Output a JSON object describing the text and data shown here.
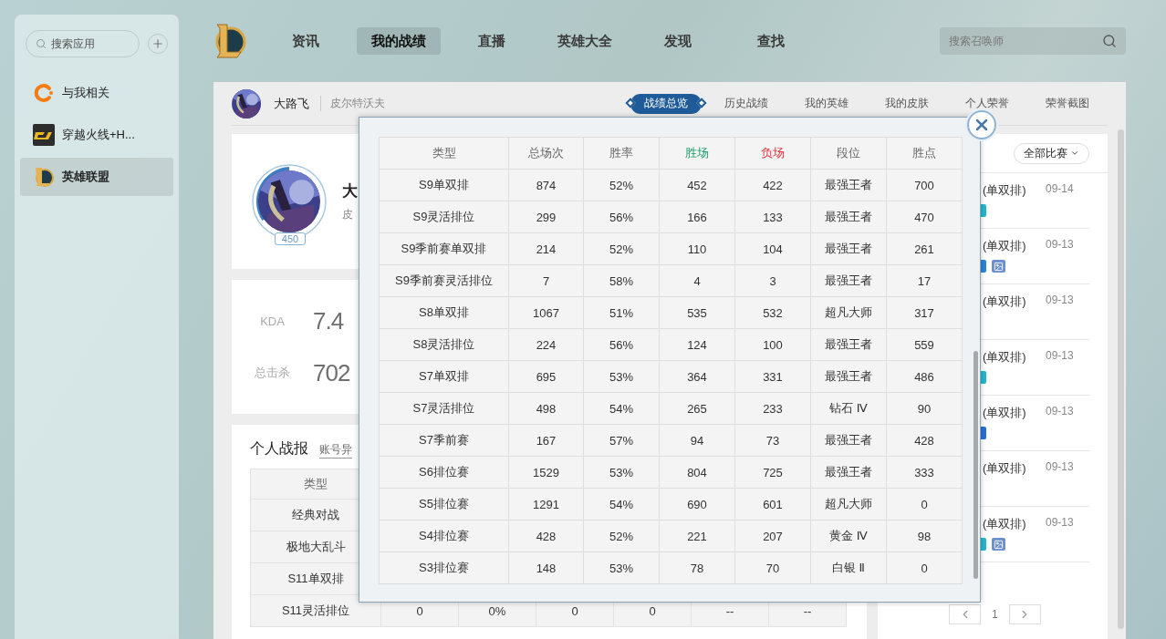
{
  "sidebar": {
    "search": {
      "placeholder": "搜索应用"
    },
    "items": [
      {
        "label": "与我相关",
        "kind": "feed",
        "selected": false
      },
      {
        "label": "穿越火线+H...",
        "kind": "shooter",
        "selected": false
      },
      {
        "label": "英雄联盟",
        "kind": "moba",
        "selected": true
      }
    ]
  },
  "nav": {
    "items": [
      {
        "label": "资讯",
        "selected": false
      },
      {
        "label": "我的战绩",
        "selected": true
      },
      {
        "label": "直播",
        "selected": false
      },
      {
        "label": "英雄大全",
        "selected": false
      },
      {
        "label": "发现",
        "selected": false
      },
      {
        "label": "查找",
        "selected": false
      }
    ],
    "search": {
      "placeholder": "搜索召唤师"
    }
  },
  "header": {
    "name": "大路飞",
    "server": "皮尔特沃夫"
  },
  "tabs": [
    {
      "label": "战绩总览",
      "selected": true
    },
    {
      "label": "历史战绩",
      "selected": false
    },
    {
      "label": "我的英雄",
      "selected": false
    },
    {
      "label": "我的皮肤",
      "selected": false
    },
    {
      "label": "个人荣誉",
      "selected": false
    },
    {
      "label": "荣誉截图",
      "selected": false
    }
  ],
  "profile_card": {
    "name": "大",
    "server": "皮",
    "level": "450"
  },
  "stats": [
    {
      "label": "KDA",
      "value": "7.4"
    },
    {
      "label": "总击杀",
      "value": "702"
    }
  ],
  "report": {
    "title": "个人战报",
    "link": "账号异",
    "columns": [
      "类型"
    ],
    "rows": [
      {
        "type": "经典对战"
      },
      {
        "type": "极地大乱斗"
      },
      {
        "type": "S11单双排"
      },
      {
        "type": "S11灵活排位",
        "cells": [
          "0",
          "0%",
          "0",
          "0",
          "--",
          "--"
        ]
      }
    ]
  },
  "matches": {
    "filter": "全部比赛",
    "items": [
      {
        "mode": "(单双排)",
        "date": "09-14",
        "badge": {
          "color": "#22b8cc"
        },
        "screenshot": false
      },
      {
        "mode": "(单双排)",
        "date": "09-13",
        "badge": {
          "color": "#2a86d6"
        },
        "screenshot": true
      },
      {
        "mode": "(单双排)",
        "date": "09-13",
        "screenshot": false
      },
      {
        "mode": "(单双排)",
        "date": "09-13",
        "badge": {
          "color": "#22b8cc"
        },
        "screenshot": false
      },
      {
        "mode": "(单双排)",
        "date": "09-13",
        "badge": {
          "color": "#2a6fd6"
        },
        "screenshot": false
      },
      {
        "mode": "(单双排)",
        "date": "09-13",
        "screenshot": false
      },
      {
        "mode": "(单双排)",
        "date": "09-13",
        "badge": {
          "color": "#22b8cc"
        },
        "screenshot": true
      }
    ],
    "page": "1"
  },
  "modal": {
    "columns": [
      {
        "label": "类型",
        "kind": "plain"
      },
      {
        "label": "总场次",
        "kind": "plain"
      },
      {
        "label": "胜率",
        "kind": "plain"
      },
      {
        "label": "胜场",
        "kind": "win"
      },
      {
        "label": "负场",
        "kind": "loss"
      },
      {
        "label": "段位",
        "kind": "plain"
      },
      {
        "label": "胜点",
        "kind": "plain"
      }
    ],
    "rows": [
      [
        "S9单双排",
        "874",
        "52%",
        "452",
        "422",
        "最强王者",
        "700"
      ],
      [
        "S9灵活排位",
        "299",
        "56%",
        "166",
        "133",
        "最强王者",
        "470"
      ],
      [
        "S9季前赛单双排",
        "214",
        "52%",
        "110",
        "104",
        "最强王者",
        "261"
      ],
      [
        "S9季前赛灵活排位",
        "7",
        "58%",
        "4",
        "3",
        "最强王者",
        "17"
      ],
      [
        "S8单双排",
        "1067",
        "51%",
        "535",
        "532",
        "超凡大师",
        "317"
      ],
      [
        "S8灵活排位",
        "224",
        "56%",
        "124",
        "100",
        "最强王者",
        "559"
      ],
      [
        "S7单双排",
        "695",
        "53%",
        "364",
        "331",
        "最强王者",
        "486"
      ],
      [
        "S7灵活排位",
        "498",
        "54%",
        "265",
        "233",
        "钻石 Ⅳ",
        "90"
      ],
      [
        "S7季前赛",
        "167",
        "57%",
        "94",
        "73",
        "最强王者",
        "428"
      ],
      [
        "S6排位赛",
        "1529",
        "53%",
        "804",
        "725",
        "最强王者",
        "333"
      ],
      [
        "S5排位赛",
        "1291",
        "54%",
        "690",
        "601",
        "超凡大师",
        "0"
      ],
      [
        "S4排位赛",
        "428",
        "52%",
        "221",
        "207",
        "黄金 Ⅳ",
        "98"
      ],
      [
        "S3排位赛",
        "148",
        "53%",
        "78",
        "70",
        "白银 Ⅱ",
        "0"
      ]
    ]
  }
}
